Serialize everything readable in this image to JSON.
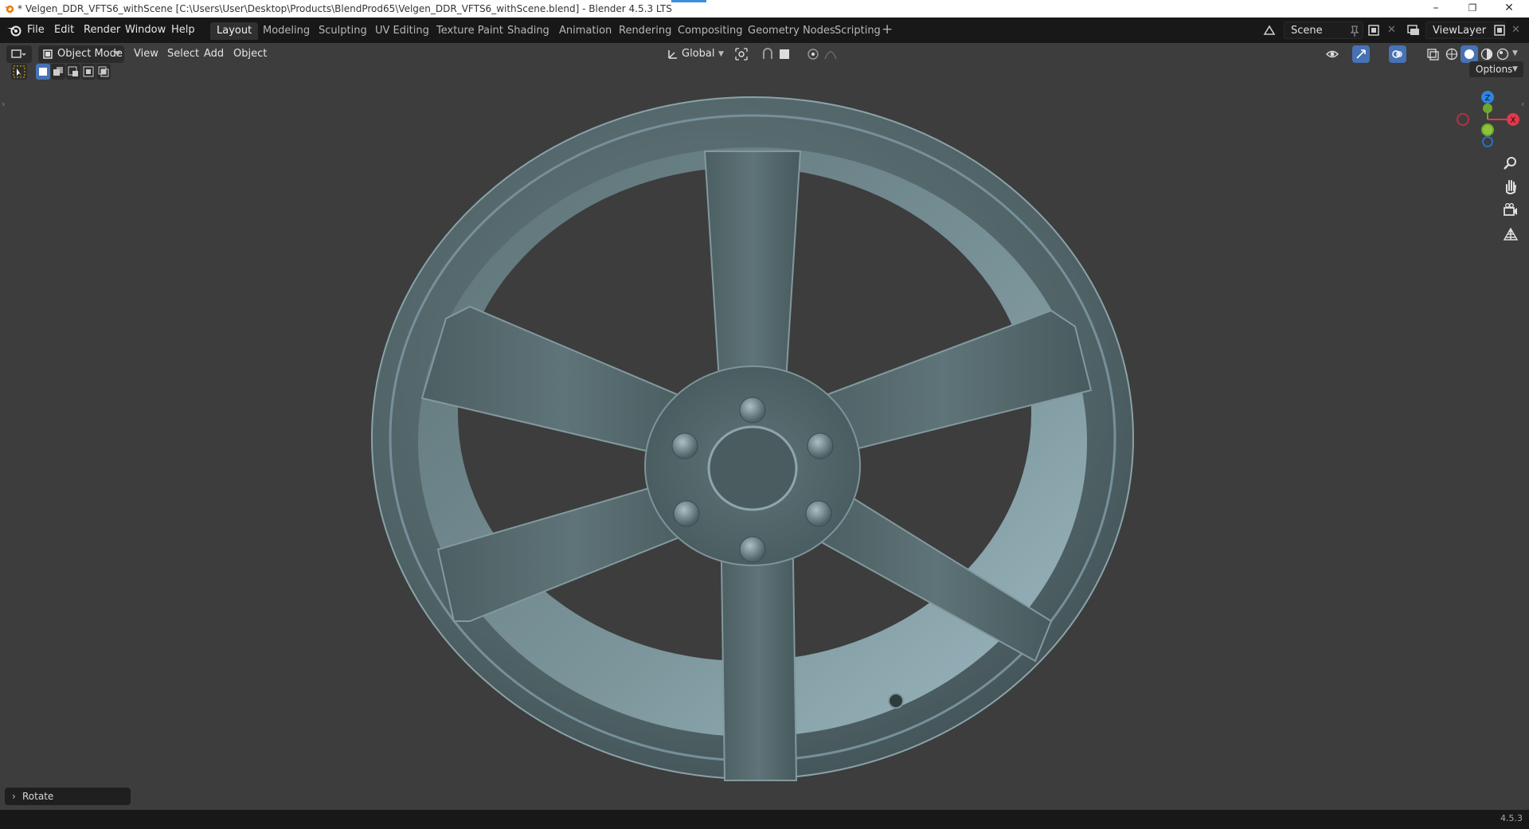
{
  "window": {
    "title": "* Velgen_DDR_VFTS6_withScene [C:\\Users\\User\\Desktop\\Products\\BlendProd65\\Velgen_DDR_VFTS6_withScene.blend] - Blender 4.5.3 LTS",
    "minimize": "–",
    "maximize": "❐",
    "close": "✕"
  },
  "menubar": {
    "items": [
      "File",
      "Edit",
      "Render",
      "Window",
      "Help"
    ]
  },
  "workspaces": {
    "tabs": [
      "Layout",
      "Modeling",
      "Sculpting",
      "UV Editing",
      "Texture Paint",
      "Shading",
      "Animation",
      "Rendering",
      "Compositing",
      "Geometry Nodes",
      "Scripting"
    ],
    "active": "Layout",
    "add_label": "+"
  },
  "scene": {
    "name": "Scene"
  },
  "view_layer": {
    "name": "ViewLayer"
  },
  "viewport_header": {
    "mode": "Object Mode",
    "menus": [
      "View",
      "Select",
      "Add",
      "Object"
    ],
    "transform_orientation": "Global"
  },
  "viewport": {
    "options_label": "Options",
    "gizmo_axes": {
      "z": "Z",
      "y": "Y",
      "x": "X"
    },
    "colors": {
      "x": "#e0384a",
      "y": "#6ea82a",
      "z": "#2f83e3",
      "background": "#3d3d3d",
      "wheel": "#53666a"
    }
  },
  "last_operator": {
    "label": "Rotate",
    "chevron": "›"
  },
  "statusbar": {
    "version": "4.5.3"
  },
  "icons": [
    "blender-logo-icon",
    "editor-type-icon",
    "object-mode-icon",
    "select-box-icon",
    "transform-orientation-icon",
    "pivot-icon",
    "snap-icon",
    "proportional-edit-icon",
    "visibility-icon",
    "gizmo-icon",
    "overlay-icon",
    "xray-icon",
    "shading-wireframe-icon",
    "shading-solid-icon",
    "shading-material-icon",
    "shading-rendered-icon",
    "zoom-icon",
    "pan-hand-icon",
    "camera-icon",
    "ortho-grid-icon",
    "pin-icon",
    "new-scene-icon",
    "view-layer-icon"
  ]
}
